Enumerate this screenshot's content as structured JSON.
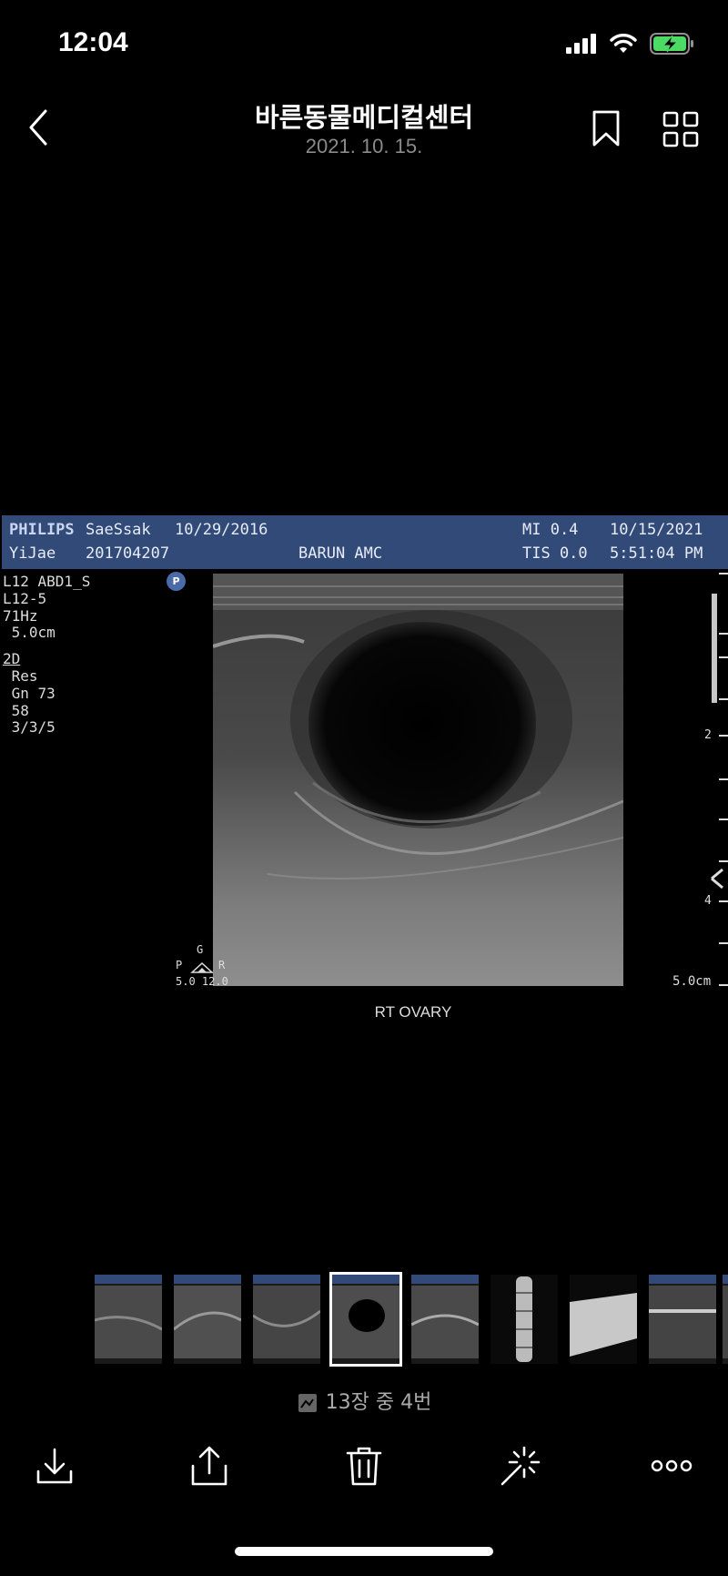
{
  "status_bar": {
    "time": "12:04"
  },
  "nav": {
    "title": "바른동물메디컬센터",
    "subtitle": "2021. 10. 15."
  },
  "ultrasound": {
    "header": {
      "brand": "PHILIPS",
      "patient_name": "SaeSsak",
      "birth_date": "10/29/2016",
      "mi": "MI 0.4",
      "date": "10/15/2021",
      "operator": "YiJae",
      "patient_id": "201704207",
      "institution": "BARUN AMC",
      "tis": "TIS 0.0",
      "time": "5:51:04 PM"
    },
    "left_panel": {
      "preset": "L12 ABD1_S",
      "probe": "L12-5",
      "frame_rate": "71Hz",
      "depth": " 5.0cm",
      "mode": "2D",
      "res": " Res",
      "gain": " Gn 73",
      "value": " 58",
      "setting": " 3/3/5"
    },
    "badge": "P",
    "probe_marks": {
      "g": "G",
      "p": "P",
      "r": "R",
      "values": "5.0 12.0"
    },
    "scale_marks": [
      "2",
      "4"
    ],
    "depth_label": "5.0cm",
    "caption": "RT OVARY"
  },
  "thumbnails": [
    {
      "kind": "ultrasound",
      "selected": false
    },
    {
      "kind": "ultrasound",
      "selected": false
    },
    {
      "kind": "ultrasound",
      "selected": false
    },
    {
      "kind": "ultrasound-ovary",
      "selected": true
    },
    {
      "kind": "ultrasound",
      "selected": false
    },
    {
      "kind": "xray-spine",
      "selected": false
    },
    {
      "kind": "xray-limb",
      "selected": false
    },
    {
      "kind": "ultrasound",
      "selected": false
    }
  ],
  "counter": {
    "text": "13장 중 4번"
  },
  "toolbar": {
    "icons": [
      "download-icon",
      "share-icon",
      "trash-icon",
      "magic-wand-icon",
      "more-icon"
    ]
  }
}
